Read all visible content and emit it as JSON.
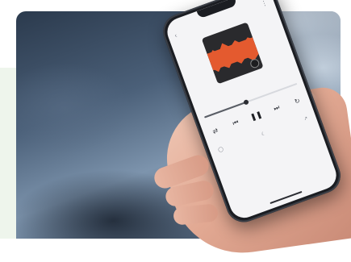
{
  "scene": {
    "description_colors": {
      "background_panel": "#eef5ec",
      "cover_accent": "#e45a2f"
    }
  },
  "player": {
    "cover_text": "",
    "title": "",
    "subtitle": "",
    "progress": 0.45,
    "left_button": "",
    "right_button": ""
  },
  "icons": {
    "back": "chevron-down-icon",
    "more": "more-icon",
    "shuffle": "shuffle-icon",
    "previous": "skip-back-icon",
    "play_pause": "pause-icon",
    "next": "skip-forward-icon",
    "repeat": "repeat-icon",
    "speed": "speed-icon",
    "sleep": "sleep-timer-icon",
    "share": "share-icon"
  }
}
